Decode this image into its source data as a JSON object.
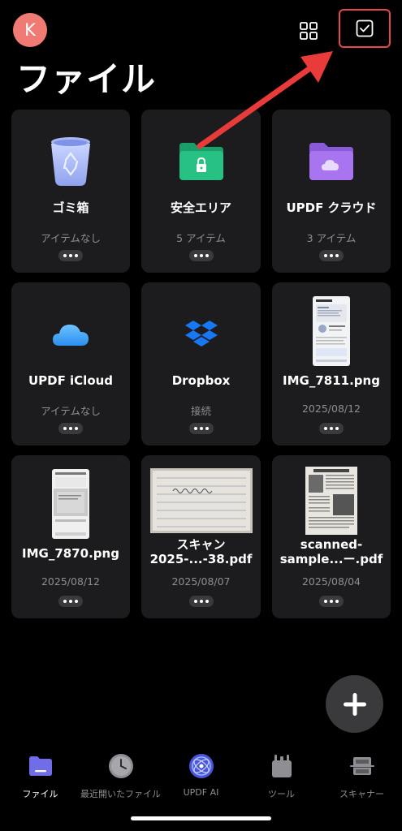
{
  "header": {
    "avatar_letter": "K",
    "title": "ファイル",
    "icons": [
      "grid-view-icon",
      "select-checkbox-icon"
    ]
  },
  "items": [
    {
      "name": "ゴミ箱",
      "sub": "アイテムなし",
      "icon": "trash-icon"
    },
    {
      "name": "安全エリア",
      "sub": "5 アイテム",
      "icon": "secure-folder-icon"
    },
    {
      "name": "UPDF クラウド",
      "sub": "3 アイテム",
      "icon": "cloud-folder-icon"
    },
    {
      "name": "UPDF iCloud",
      "sub": "アイテムなし",
      "icon": "icloud-icon"
    },
    {
      "name": "Dropbox",
      "sub": "接続",
      "icon": "dropbox-icon"
    },
    {
      "name": "IMG_7811.png",
      "sub": "2025/08/12",
      "icon": "screenshot-thumbnail"
    },
    {
      "name": "IMG_7870.png",
      "sub": "2025/08/12",
      "icon": "screenshot-thumbnail"
    },
    {
      "name": "スキャン\n2025-...-38.pdf",
      "sub": "2025/08/07",
      "icon": "scan-thumbnail"
    },
    {
      "name": "scanned-\nsample...ー.pdf",
      "sub": "2025/08/04",
      "icon": "newspaper-thumbnail"
    }
  ],
  "nav": [
    {
      "label": "ファイル",
      "icon": "files-icon",
      "active": true
    },
    {
      "label": "最近開いたファイル",
      "icon": "clock-icon",
      "active": false
    },
    {
      "label": "UPDF AI",
      "icon": "ai-icon",
      "active": false
    },
    {
      "label": "ツール",
      "icon": "tools-icon",
      "active": false
    },
    {
      "label": "スキャナー",
      "icon": "scanner-icon",
      "active": false
    }
  ],
  "colors": {
    "background": "#000000",
    "card": "#1c1c1e",
    "avatar": "#f07b74",
    "highlight": "#e5484d",
    "subtext": "#8e8e93"
  }
}
